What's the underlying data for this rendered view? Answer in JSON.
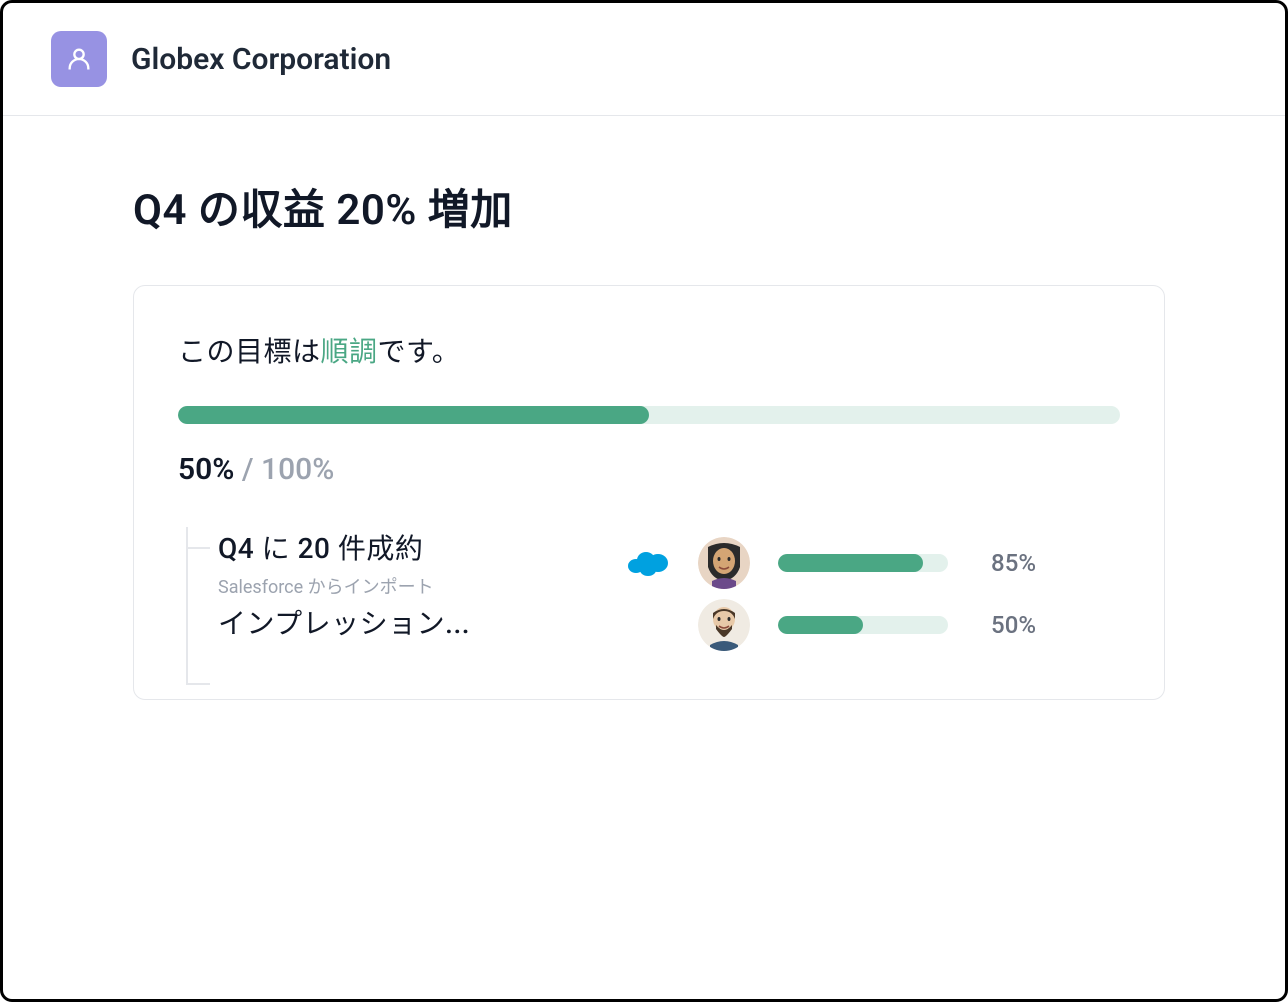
{
  "header": {
    "org_name": "Globex Corporation"
  },
  "page": {
    "title": "Q4 の収益 20% 増加"
  },
  "goal": {
    "status_prefix": "この目標は",
    "status_highlight": "順調",
    "status_suffix": "です。",
    "progress_pct": 50,
    "progress_current": "50%",
    "progress_sep": " / ",
    "progress_total": "100%"
  },
  "sub_goals": [
    {
      "title": "Q4 に 20 件成約",
      "subtitle": "Salesforce からインポート",
      "has_salesforce": true,
      "progress_pct": 85,
      "pct_label": "85%"
    },
    {
      "title": "インプレッション...",
      "subtitle": "",
      "has_salesforce": false,
      "progress_pct": 50,
      "pct_label": "50%"
    }
  ]
}
